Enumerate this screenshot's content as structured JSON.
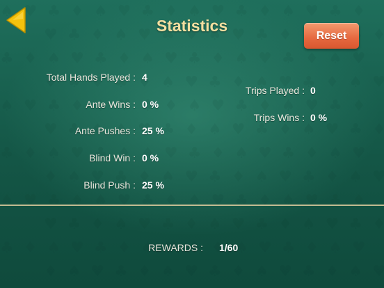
{
  "header": {
    "title": "Statistics",
    "reset_label": "Reset"
  },
  "left_stats": [
    {
      "label": "Total Hands Played :",
      "value": "4"
    },
    {
      "label": "Ante Wins :",
      "value": "0 %"
    },
    {
      "label": "Ante Pushes :",
      "value": "25 %"
    },
    {
      "label": "Blind Win :",
      "value": "0 %"
    },
    {
      "label": "Blind Push :",
      "value": "25 %"
    }
  ],
  "right_stats": [
    {
      "label": "Trips Played :",
      "value": "0"
    },
    {
      "label": "Trips Wins :",
      "value": "0 %"
    }
  ],
  "rewards": {
    "label": "REWARDS :",
    "value": "1/60"
  },
  "colors": {
    "felt_green": "#145646",
    "title_gold": "#f3dfa0",
    "back_arrow_yellow": "#f4c20d",
    "reset_orange": "#e6683f",
    "divider": "#d6c79a"
  }
}
